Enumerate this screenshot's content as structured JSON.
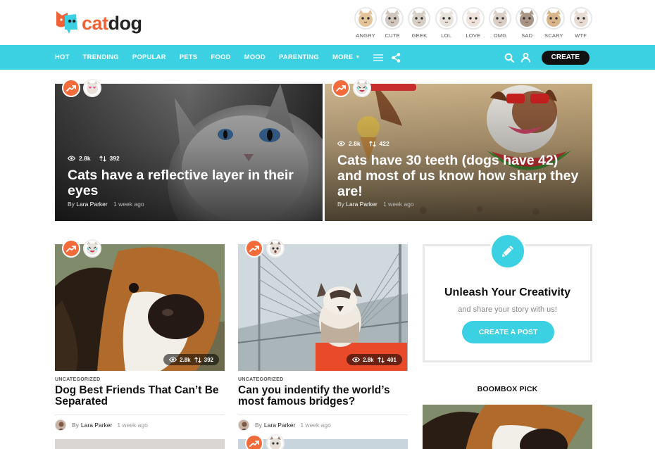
{
  "logo": {
    "part1": "cat",
    "part2": "dog"
  },
  "reactions": [
    {
      "label": "ANGRY",
      "icon": "angry-cat-icon"
    },
    {
      "label": "CUTE",
      "icon": "cute-cat-icon"
    },
    {
      "label": "GEEK",
      "icon": "geek-cat-icon"
    },
    {
      "label": "LOL",
      "icon": "lol-cat-icon"
    },
    {
      "label": "LOVE",
      "icon": "love-cat-icon"
    },
    {
      "label": "OMG",
      "icon": "omg-cat-icon"
    },
    {
      "label": "SAD",
      "icon": "sad-cat-icon"
    },
    {
      "label": "SCARY",
      "icon": "scary-cat-icon"
    },
    {
      "label": "WTF",
      "icon": "wtf-cat-icon"
    }
  ],
  "nav": {
    "items": [
      "HOT",
      "TRENDING",
      "POPULAR",
      "PETS",
      "FOOD",
      "MOOD",
      "PARENTING"
    ],
    "more": "MORE",
    "create": "CREATE"
  },
  "colors": {
    "accent": "#3bd1e2",
    "trending": "#f36a3b",
    "brand_orange": "#f06236"
  },
  "hero": [
    {
      "views": "2.8k",
      "shares": "392",
      "title": "Cats have a reflective layer in their eyes",
      "by": "By",
      "author": "Lara Parker",
      "time": "1 week ago"
    },
    {
      "views": "2.8k",
      "shares": "422",
      "title": "Cats have 30 teeth (dogs have 42) and most of us know how sharp they are!",
      "by": "By",
      "author": "Lara Parker",
      "time": "1 week ago"
    }
  ],
  "cards": [
    {
      "views": "2.8k",
      "shares": "392",
      "category": "UNCATEGORIZED",
      "title": "Dog Best Friends That Can’t Be Separated",
      "by": "By",
      "author": "Lara Parker",
      "time": "1 week ago"
    },
    {
      "views": "2.8k",
      "shares": "401",
      "category": "UNCATEGORIZED",
      "title": "Can you indentify the world’s most famous bridges?",
      "by": "By",
      "author": "Lara Parker",
      "time": "1 week ago"
    }
  ],
  "sidebar": {
    "cta_title": "Unleash Your Creativity",
    "cta_sub": "and share your story with us!",
    "cta_button": "CREATE A POST",
    "pick_title": "BOOMBOX PICK"
  }
}
